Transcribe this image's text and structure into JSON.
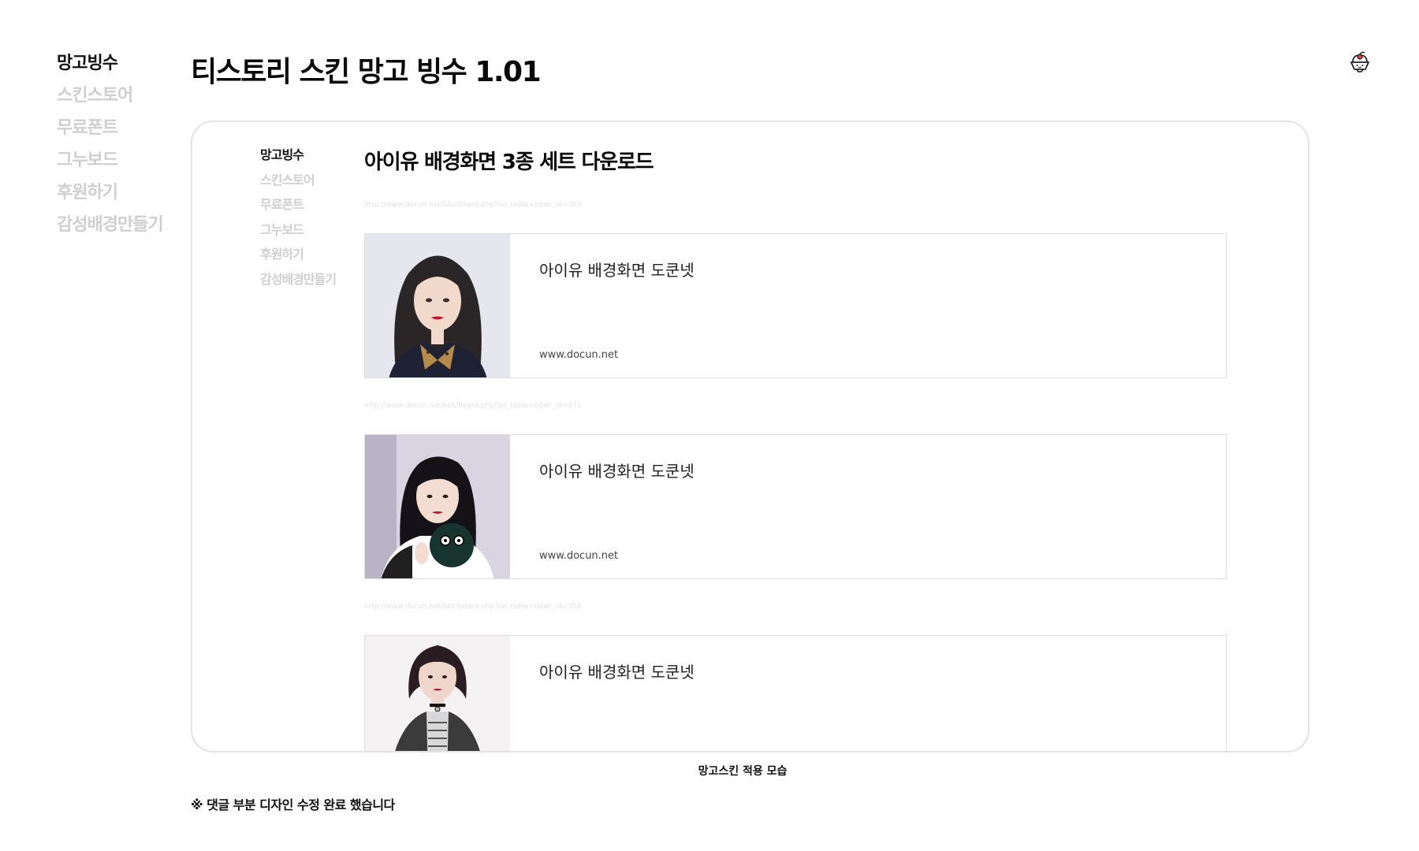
{
  "site": {
    "title": "티스토리 스킨 망고 빙수 1.01"
  },
  "left_nav": {
    "items": [
      {
        "label": "망고빙수",
        "active": true
      },
      {
        "label": "스킨스토어",
        "active": false
      },
      {
        "label": "무료폰트",
        "active": false
      },
      {
        "label": "그누보드",
        "active": false
      },
      {
        "label": "후원하기",
        "active": false
      },
      {
        "label": "감성배경만들기",
        "active": false
      }
    ]
  },
  "preview": {
    "nav": {
      "items": [
        {
          "label": "망고빙수",
          "active": true
        },
        {
          "label": "스킨스토어",
          "active": false
        },
        {
          "label": "무료폰트",
          "active": false
        },
        {
          "label": "그누보드",
          "active": false
        },
        {
          "label": "후원하기",
          "active": false
        },
        {
          "label": "감성배경만들기",
          "active": false
        }
      ]
    },
    "post_title": "아이유 배경화면 3종 세트 다운로드",
    "cards": [
      {
        "url": "http://www.docun.net/bbs/board.php?bo_table=b8wr_id=369",
        "title": "아이유 배경화면 도쿤넷",
        "domain": "www.docun.net"
      },
      {
        "url": "http://www.docun.net/bbs/board.php?bo_table=b8wr_id=371",
        "title": "아이유 배경화면 도쿤넷",
        "domain": "www.docun.net"
      },
      {
        "url": "http://www.docun.net/bbs/board.php?bo_table=b8wr_id=368",
        "title": "아이유 배경화면 도쿤넷",
        "domain": ""
      }
    ]
  },
  "caption": "망고스킨 적용 모습",
  "footer_note": "※ 댓글 부분 디자인 수정 완료 했습니다",
  "icons": {
    "mascot": "mango-bingsu-mascot-icon"
  },
  "colors": {
    "text": "#111111",
    "inactive_nav": "#cfcfcf",
    "frame_border": "#e3e3e3"
  }
}
